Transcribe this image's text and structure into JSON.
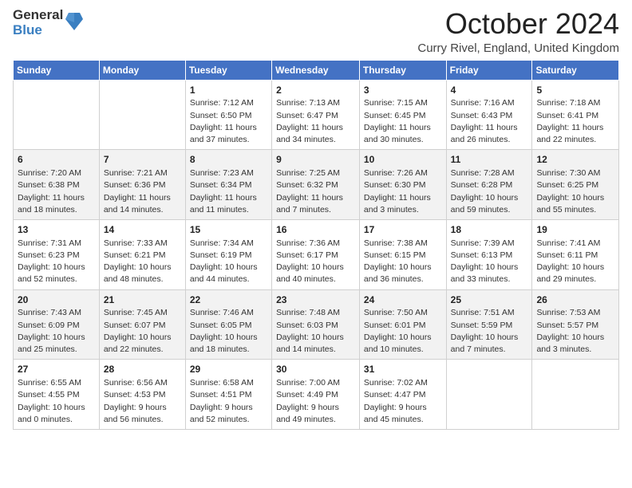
{
  "logo": {
    "general": "General",
    "blue": "Blue"
  },
  "header": {
    "month": "October 2024",
    "location": "Curry Rivel, England, United Kingdom"
  },
  "weekdays": [
    "Sunday",
    "Monday",
    "Tuesday",
    "Wednesday",
    "Thursday",
    "Friday",
    "Saturday"
  ],
  "weeks": [
    [
      {
        "day": "",
        "info": ""
      },
      {
        "day": "",
        "info": ""
      },
      {
        "day": "1",
        "info": "Sunrise: 7:12 AM\nSunset: 6:50 PM\nDaylight: 11 hours and 37 minutes."
      },
      {
        "day": "2",
        "info": "Sunrise: 7:13 AM\nSunset: 6:47 PM\nDaylight: 11 hours and 34 minutes."
      },
      {
        "day": "3",
        "info": "Sunrise: 7:15 AM\nSunset: 6:45 PM\nDaylight: 11 hours and 30 minutes."
      },
      {
        "day": "4",
        "info": "Sunrise: 7:16 AM\nSunset: 6:43 PM\nDaylight: 11 hours and 26 minutes."
      },
      {
        "day": "5",
        "info": "Sunrise: 7:18 AM\nSunset: 6:41 PM\nDaylight: 11 hours and 22 minutes."
      }
    ],
    [
      {
        "day": "6",
        "info": "Sunrise: 7:20 AM\nSunset: 6:38 PM\nDaylight: 11 hours and 18 minutes."
      },
      {
        "day": "7",
        "info": "Sunrise: 7:21 AM\nSunset: 6:36 PM\nDaylight: 11 hours and 14 minutes."
      },
      {
        "day": "8",
        "info": "Sunrise: 7:23 AM\nSunset: 6:34 PM\nDaylight: 11 hours and 11 minutes."
      },
      {
        "day": "9",
        "info": "Sunrise: 7:25 AM\nSunset: 6:32 PM\nDaylight: 11 hours and 7 minutes."
      },
      {
        "day": "10",
        "info": "Sunrise: 7:26 AM\nSunset: 6:30 PM\nDaylight: 11 hours and 3 minutes."
      },
      {
        "day": "11",
        "info": "Sunrise: 7:28 AM\nSunset: 6:28 PM\nDaylight: 10 hours and 59 minutes."
      },
      {
        "day": "12",
        "info": "Sunrise: 7:30 AM\nSunset: 6:25 PM\nDaylight: 10 hours and 55 minutes."
      }
    ],
    [
      {
        "day": "13",
        "info": "Sunrise: 7:31 AM\nSunset: 6:23 PM\nDaylight: 10 hours and 52 minutes."
      },
      {
        "day": "14",
        "info": "Sunrise: 7:33 AM\nSunset: 6:21 PM\nDaylight: 10 hours and 48 minutes."
      },
      {
        "day": "15",
        "info": "Sunrise: 7:34 AM\nSunset: 6:19 PM\nDaylight: 10 hours and 44 minutes."
      },
      {
        "day": "16",
        "info": "Sunrise: 7:36 AM\nSunset: 6:17 PM\nDaylight: 10 hours and 40 minutes."
      },
      {
        "day": "17",
        "info": "Sunrise: 7:38 AM\nSunset: 6:15 PM\nDaylight: 10 hours and 36 minutes."
      },
      {
        "day": "18",
        "info": "Sunrise: 7:39 AM\nSunset: 6:13 PM\nDaylight: 10 hours and 33 minutes."
      },
      {
        "day": "19",
        "info": "Sunrise: 7:41 AM\nSunset: 6:11 PM\nDaylight: 10 hours and 29 minutes."
      }
    ],
    [
      {
        "day": "20",
        "info": "Sunrise: 7:43 AM\nSunset: 6:09 PM\nDaylight: 10 hours and 25 minutes."
      },
      {
        "day": "21",
        "info": "Sunrise: 7:45 AM\nSunset: 6:07 PM\nDaylight: 10 hours and 22 minutes."
      },
      {
        "day": "22",
        "info": "Sunrise: 7:46 AM\nSunset: 6:05 PM\nDaylight: 10 hours and 18 minutes."
      },
      {
        "day": "23",
        "info": "Sunrise: 7:48 AM\nSunset: 6:03 PM\nDaylight: 10 hours and 14 minutes."
      },
      {
        "day": "24",
        "info": "Sunrise: 7:50 AM\nSunset: 6:01 PM\nDaylight: 10 hours and 10 minutes."
      },
      {
        "day": "25",
        "info": "Sunrise: 7:51 AM\nSunset: 5:59 PM\nDaylight: 10 hours and 7 minutes."
      },
      {
        "day": "26",
        "info": "Sunrise: 7:53 AM\nSunset: 5:57 PM\nDaylight: 10 hours and 3 minutes."
      }
    ],
    [
      {
        "day": "27",
        "info": "Sunrise: 6:55 AM\nSunset: 4:55 PM\nDaylight: 10 hours and 0 minutes."
      },
      {
        "day": "28",
        "info": "Sunrise: 6:56 AM\nSunset: 4:53 PM\nDaylight: 9 hours and 56 minutes."
      },
      {
        "day": "29",
        "info": "Sunrise: 6:58 AM\nSunset: 4:51 PM\nDaylight: 9 hours and 52 minutes."
      },
      {
        "day": "30",
        "info": "Sunrise: 7:00 AM\nSunset: 4:49 PM\nDaylight: 9 hours and 49 minutes."
      },
      {
        "day": "31",
        "info": "Sunrise: 7:02 AM\nSunset: 4:47 PM\nDaylight: 9 hours and 45 minutes."
      },
      {
        "day": "",
        "info": ""
      },
      {
        "day": "",
        "info": ""
      }
    ]
  ]
}
